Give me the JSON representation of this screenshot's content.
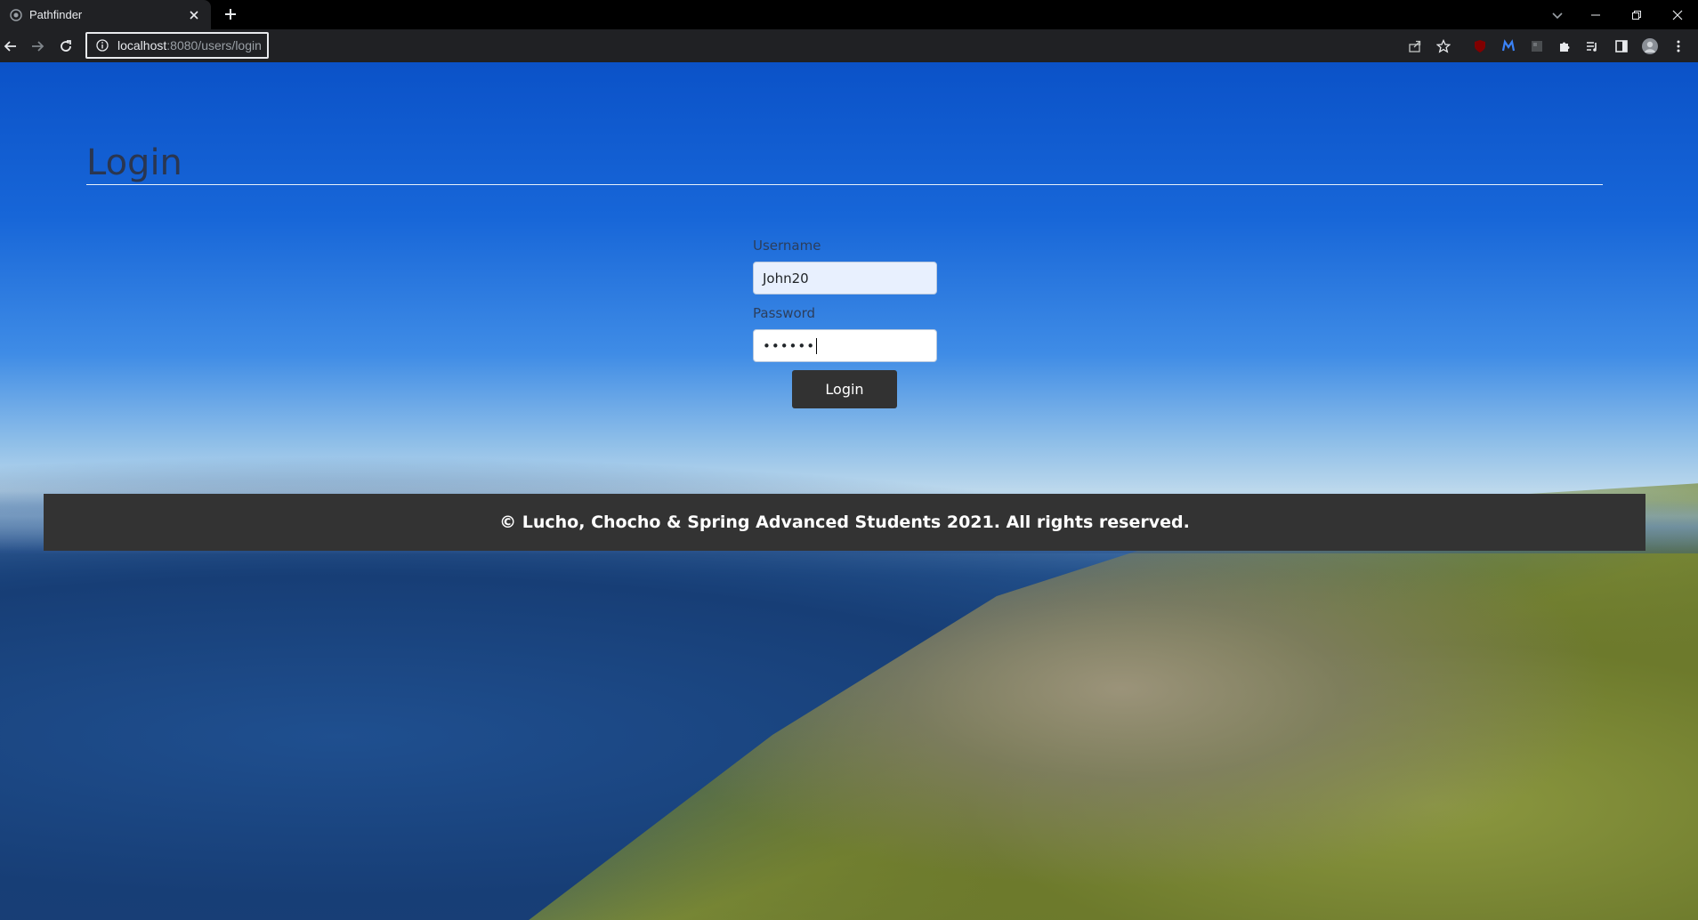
{
  "browser": {
    "tab_title": "Pathfinder",
    "url_host": "localhost",
    "url_rest": ":8080/users/login"
  },
  "page": {
    "heading": "Login",
    "username_label": "Username",
    "username_value": "John20",
    "password_label": "Password",
    "password_value": "••••••",
    "login_button": "Login",
    "footer_text": "© Lucho, Chocho & Spring Advanced Students 2021. All rights reserved."
  },
  "colors": {
    "footer_bg": "#333333",
    "button_bg": "#323232",
    "autofill_bg": "#e8f0fe"
  }
}
